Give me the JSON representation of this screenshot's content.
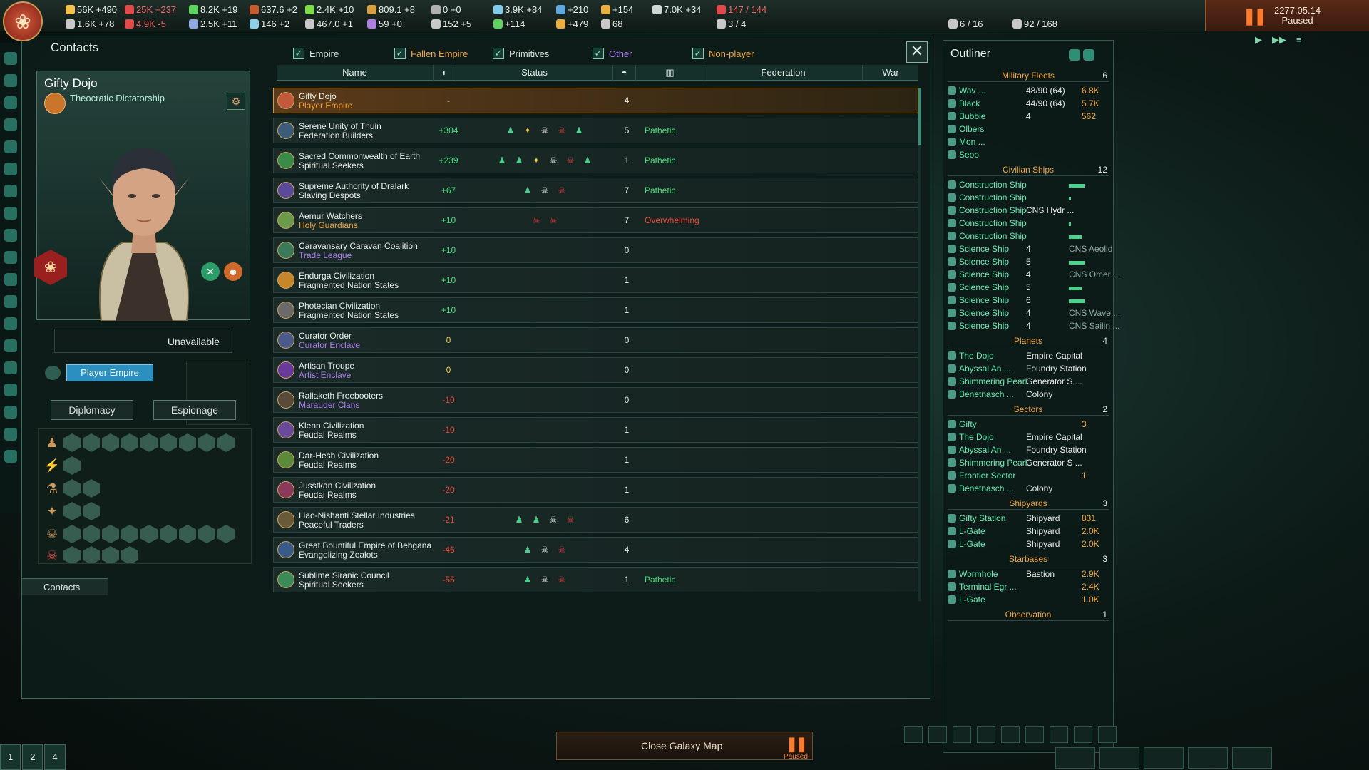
{
  "topbar": {
    "resources": [
      {
        "label": "56K +490",
        "color": "#f2c14e"
      },
      {
        "label": "25K +237",
        "color": "#e04a4a"
      },
      {
        "label": "8.2K +19",
        "color": "#5fd35f"
      },
      {
        "label": "637.6 +2",
        "color": "#c65b2f"
      },
      {
        "label": "2.4K +10",
        "color": "#7fdc4a"
      },
      {
        "label": "809.1 +8",
        "color": "#d8a040"
      },
      {
        "label": "0 +0",
        "color": "#b0b0b0"
      },
      {
        "label": "3.9K +84",
        "color": "#7fcbe8"
      },
      {
        "label": "+210",
        "color": "#5fa8e0"
      },
      {
        "label": "+154",
        "color": "#e8b040"
      },
      {
        "label": "7.0K +34",
        "color": "#cfd8d4"
      },
      {
        "label": "147 / 144",
        "color": "#e04a4a"
      },
      {
        "label": "1.6K +78",
        "color": "#c8c8c8"
      },
      {
        "label": "4.9K -5",
        "color": "#e04a4a"
      },
      {
        "label": "2.5K +11",
        "color": "#8fa8e0"
      },
      {
        "label": "146 +2",
        "color": "#8fd0e8"
      },
      {
        "label": "467.0 +1",
        "color": "#c8c8c8"
      },
      {
        "label": "59 +0",
        "color": "#b080e0"
      },
      {
        "label": "152 +5",
        "color": "#c8c8c8"
      },
      {
        "label": "+114",
        "color": "#5fd35f"
      },
      {
        "label": "+479",
        "color": "#e8b040"
      },
      {
        "label": "68",
        "color": "#c8c8c8"
      },
      {
        "label": "3 / 4",
        "color": "#c8c8c8"
      },
      {
        "label": "6 / 16",
        "color": "#c8c8c8"
      },
      {
        "label": "92 / 168",
        "color": "#c8c8c8"
      }
    ],
    "date": "2277.05.14",
    "paused": "Paused"
  },
  "contacts": {
    "title": "Contacts",
    "close": "✕",
    "card": {
      "name": "Gifty Dojo",
      "government": "Theocratic Dictatorship",
      "status": "Unavailable",
      "player_badge": "Player Empire"
    },
    "buttons": {
      "diplomacy": "Diplomacy",
      "espionage": "Espionage"
    },
    "filters": [
      {
        "label": "Empire",
        "color": "#e8ece9"
      },
      {
        "label": "Fallen Empire",
        "color": "#f0a63a"
      },
      {
        "label": "Primitives",
        "color": "#e8ece9"
      },
      {
        "label": "Other",
        "color": "#b07ff0"
      },
      {
        "label": "Non-player",
        "color": "#f0a63a"
      }
    ],
    "headers": {
      "name": "Name",
      "status": "Status",
      "federation": "Federation",
      "war": "War"
    },
    "rows": [
      {
        "name": "Gifty Dojo",
        "type": "Player Empire",
        "type_color": "#f0a63a",
        "opinion": "-",
        "op_color": "#e8ece9",
        "status": [],
        "num": "4",
        "fed": "",
        "fed_color": "#3fe07a",
        "selected": true,
        "badge": "#c2593a"
      },
      {
        "name": "Serene Unity of Thuin",
        "type": "Federation Builders",
        "type_color": "#e8ece9",
        "opinion": "+304",
        "op_color": "#3fe07a",
        "status": [
          "green",
          "gold",
          "skull",
          "red",
          "green"
        ],
        "num": "5",
        "fed": "Pathetic",
        "fed_color": "#3fe07a",
        "badge": "#3b5d7a"
      },
      {
        "name": "Sacred Commonwealth of Earth",
        "type": "Spiritual Seekers",
        "type_color": "#e8ece9",
        "opinion": "+239",
        "op_color": "#3fe07a",
        "status": [
          "green",
          "green",
          "gold",
          "skull",
          "red",
          "green"
        ],
        "num": "1",
        "fed": "Pathetic",
        "fed_color": "#3fe07a",
        "badge": "#3a8a4a"
      },
      {
        "name": "Supreme Authority of Dralark",
        "type": "Slaving Despots",
        "type_color": "#e8ece9",
        "opinion": "+67",
        "op_color": "#3fe07a",
        "status": [
          "green",
          "skull",
          "red"
        ],
        "num": "7",
        "fed": "Pathetic",
        "fed_color": "#3fe07a",
        "badge": "#5a4a9a"
      },
      {
        "name": "Aemur Watchers",
        "type": "Holy Guardians",
        "type_color": "#f0a63a",
        "opinion": "+10",
        "op_color": "#3fe07a",
        "status": [
          "red",
          "red"
        ],
        "num": "7",
        "fed": "Overwhelming",
        "fed_color": "#f04a3a",
        "badge": "#6a9a4a"
      },
      {
        "name": "Caravansary Caravan Coalition",
        "type": "Trade League",
        "type_color": "#b07ff0",
        "opinion": "+10",
        "op_color": "#3fe07a",
        "status": [],
        "num": "0",
        "fed": "",
        "fed_color": "#3fe07a",
        "badge": "#3a7a5a"
      },
      {
        "name": "Endurga Civilization",
        "type": "Fragmented Nation States",
        "type_color": "#e8ece9",
        "opinion": "+10",
        "op_color": "#3fe07a",
        "status": [],
        "num": "1",
        "fed": "",
        "fed_color": "#3fe07a",
        "badge": "#c8862a"
      },
      {
        "name": "Photecian Civilization",
        "type": "Fragmented Nation States",
        "type_color": "#e8ece9",
        "opinion": "+10",
        "op_color": "#3fe07a",
        "status": [],
        "num": "1",
        "fed": "",
        "fed_color": "#3fe07a",
        "badge": "#6a6a6a"
      },
      {
        "name": "Curator Order",
        "type": "Curator Enclave",
        "type_color": "#b07ff0",
        "opinion": "0",
        "op_color": "#f0c83a",
        "status": [],
        "num": "0",
        "fed": "",
        "fed_color": "#3fe07a",
        "badge": "#4a5a8a"
      },
      {
        "name": "Artisan Troupe",
        "type": "Artist Enclave",
        "type_color": "#b07ff0",
        "opinion": "0",
        "op_color": "#f0c83a",
        "status": [],
        "num": "0",
        "fed": "",
        "fed_color": "#3fe07a",
        "badge": "#6a3a9a"
      },
      {
        "name": "Rallaketh Freebooters",
        "type": "Marauder Clans",
        "type_color": "#b07ff0",
        "opinion": "-10",
        "op_color": "#f04a3a",
        "status": [],
        "num": "0",
        "fed": "",
        "fed_color": "#3fe07a",
        "badge": "#5a4a3a"
      },
      {
        "name": "Klenn Civilization",
        "type": "Feudal Realms",
        "type_color": "#e8ece9",
        "opinion": "-10",
        "op_color": "#f04a3a",
        "status": [],
        "num": "1",
        "fed": "",
        "fed_color": "#3fe07a",
        "badge": "#6a4a9a"
      },
      {
        "name": "Dar-Hesh Civilization",
        "type": "Feudal Realms",
        "type_color": "#e8ece9",
        "opinion": "-20",
        "op_color": "#f04a3a",
        "status": [],
        "num": "1",
        "fed": "",
        "fed_color": "#3fe07a",
        "badge": "#5a8a3a"
      },
      {
        "name": "Jusstkan Civilization",
        "type": "Feudal Realms",
        "type_color": "#e8ece9",
        "opinion": "-20",
        "op_color": "#f04a3a",
        "status": [],
        "num": "1",
        "fed": "",
        "fed_color": "#3fe07a",
        "badge": "#8a3a5a"
      },
      {
        "name": "Liao-Nishanti Stellar Industries",
        "type": "Peaceful Traders",
        "type_color": "#e8ece9",
        "opinion": "-21",
        "op_color": "#f04a3a",
        "status": [
          "green",
          "green",
          "skull",
          "red"
        ],
        "num": "6",
        "fed": "",
        "fed_color": "#3fe07a",
        "badge": "#6a5a3a"
      },
      {
        "name": "Great Bountiful Empire of Behgana",
        "type": "Evangelizing Zealots",
        "type_color": "#e8ece9",
        "opinion": "-46",
        "op_color": "#f04a3a",
        "status": [
          "green",
          "skull",
          "red"
        ],
        "num": "4",
        "fed": "",
        "fed_color": "#3fe07a",
        "badge": "#3a5a8a"
      },
      {
        "name": "Sublime Siranic Council",
        "type": "Spiritual Seekers",
        "type_color": "#e8ece9",
        "opinion": "-55",
        "op_color": "#f04a3a",
        "status": [
          "green",
          "skull",
          "red"
        ],
        "num": "1",
        "fed": "Pathetic",
        "fed_color": "#3fe07a",
        "badge": "#3a8a5a"
      }
    ],
    "contacts_tab": "Contacts"
  },
  "outliner": {
    "title": "Outliner",
    "sections": [
      {
        "name": "Military Fleets",
        "count": "6",
        "rows": [
          {
            "a": "Wav ...",
            "b": "48/90 (64)",
            "c": "6.8K"
          },
          {
            "a": "Black",
            "b": "44/90 (64)",
            "c": "5.7K"
          },
          {
            "a": "Bubble",
            "b": "4",
            "c": "562"
          },
          {
            "a": "Olbers",
            "b": "",
            "c": ""
          },
          {
            "a": "Mon ...",
            "b": "",
            "c": ""
          },
          {
            "a": "Seoo",
            "b": "",
            "c": ""
          }
        ]
      },
      {
        "name": "Civilian Ships",
        "count": "12",
        "rows": [
          {
            "a": "Construction Ship",
            "b": "",
            "c": "",
            "bar": 0.5
          },
          {
            "a": "Construction Ship",
            "b": "",
            "c": "",
            "bar": 0.05
          },
          {
            "a": "Construction Ship",
            "b": "CNS Hydr ...",
            "c": ""
          },
          {
            "a": "Construction Ship",
            "b": "",
            "c": "",
            "bar": 0.05
          },
          {
            "a": "Construction Ship",
            "b": "",
            "c": "",
            "bar": 0.4
          },
          {
            "a": "Science Ship",
            "b": "4",
            "c": "CNS Aeolid"
          },
          {
            "a": "Science Ship",
            "b": "5",
            "c": "",
            "bar": 0.5
          },
          {
            "a": "Science Ship",
            "b": "4",
            "c": "CNS Omer ..."
          },
          {
            "a": "Science Ship",
            "b": "5",
            "c": "",
            "bar": 0.4
          },
          {
            "a": "Science Ship",
            "b": "6",
            "c": "",
            "bar": 0.5
          },
          {
            "a": "Science Ship",
            "b": "4",
            "c": "CNS Wave ..."
          },
          {
            "a": "Science Ship",
            "b": "4",
            "c": "CNS Sailin ..."
          }
        ]
      },
      {
        "name": "Planets",
        "count": "4",
        "rows": [
          {
            "a": "The Dojo",
            "b": "Empire Capital",
            "c": ""
          },
          {
            "a": "Abyssal An ...",
            "b": "Foundry Station",
            "c": ""
          },
          {
            "a": "Shimmering Pearl",
            "b": "Generator S ...",
            "c": ""
          },
          {
            "a": "Benetnasch ...",
            "b": "Colony",
            "c": ""
          }
        ]
      },
      {
        "name": "Sectors",
        "count": "2",
        "rows": [
          {
            "a": "Gifty",
            "b": "",
            "c": "3"
          },
          {
            "a": "The Dojo",
            "b": "Empire Capital",
            "c": ""
          },
          {
            "a": "Abyssal An ...",
            "b": "Foundry Station",
            "c": ""
          },
          {
            "a": "Shimmering Pearl",
            "b": "Generator S ...",
            "c": ""
          },
          {
            "a": "Frontier Sector",
            "b": "",
            "c": "1"
          },
          {
            "a": "Benetnasch ...",
            "b": "Colony",
            "c": ""
          }
        ]
      },
      {
        "name": "Shipyards",
        "count": "3",
        "rows": [
          {
            "a": "Gifty Station",
            "b": "Shipyard",
            "c": "831"
          },
          {
            "a": "L-Gate",
            "b": "Shipyard",
            "c": "2.0K"
          },
          {
            "a": "L-Gate",
            "b": "Shipyard",
            "c": "2.0K"
          }
        ]
      },
      {
        "name": "Starbases",
        "count": "3",
        "rows": [
          {
            "a": "Wormhole",
            "b": "Bastion",
            "c": "2.9K"
          },
          {
            "a": "Terminal Egr ...",
            "b": "",
            "c": "2.4K"
          },
          {
            "a": "L-Gate",
            "b": "",
            "c": "1.0K"
          }
        ]
      },
      {
        "name": "Observation",
        "count": "1",
        "rows": []
      }
    ]
  },
  "bottom": {
    "slots": [
      "1",
      "2",
      "4"
    ],
    "galaxy": "Close Galaxy Map",
    "paused": "Paused"
  }
}
